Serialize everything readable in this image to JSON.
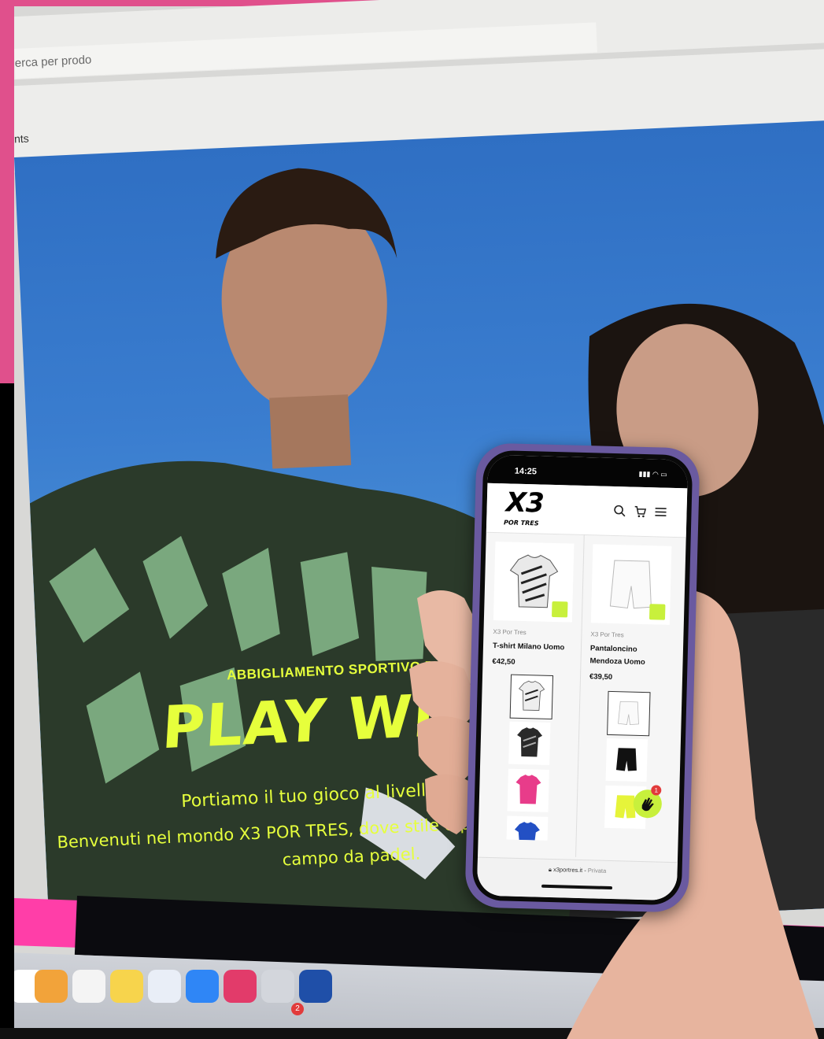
{
  "browser": {
    "search_placeholder": "erca per prodo",
    "nav_fragment": "nts"
  },
  "hero": {
    "tagline": "ABBIGLIAMENTO SPORTIVO DA PA",
    "title": "PLAY WITH",
    "subtitle": "Portiamo il tuo gioco al livello suc",
    "description_line1": "Benvenuti nel mondo X3 POR TRES, dove stile e presta",
    "description_line2": "campo da padel.",
    "accent_color": "#e6ff3c"
  },
  "dock": {
    "badge_count": "2"
  },
  "phone": {
    "status": {
      "time": "14:25"
    },
    "header": {
      "logo_main": "X3",
      "logo_sub": "POR TRES",
      "icons": [
        "search-icon",
        "cart-icon",
        "menu-icon"
      ]
    },
    "products": [
      {
        "brand": "X3 Por Tres",
        "name": "T-shirt Milano Uomo",
        "price": "€42,50"
      },
      {
        "brand": "X3 Por Tres",
        "name": "Pantaloncino Mendoza Uomo",
        "price": "€39,50"
      }
    ],
    "chat_badge": "1",
    "url": {
      "domain": "x3portres.it",
      "mode": "Privata"
    },
    "accent_color": "#c8f03c"
  }
}
